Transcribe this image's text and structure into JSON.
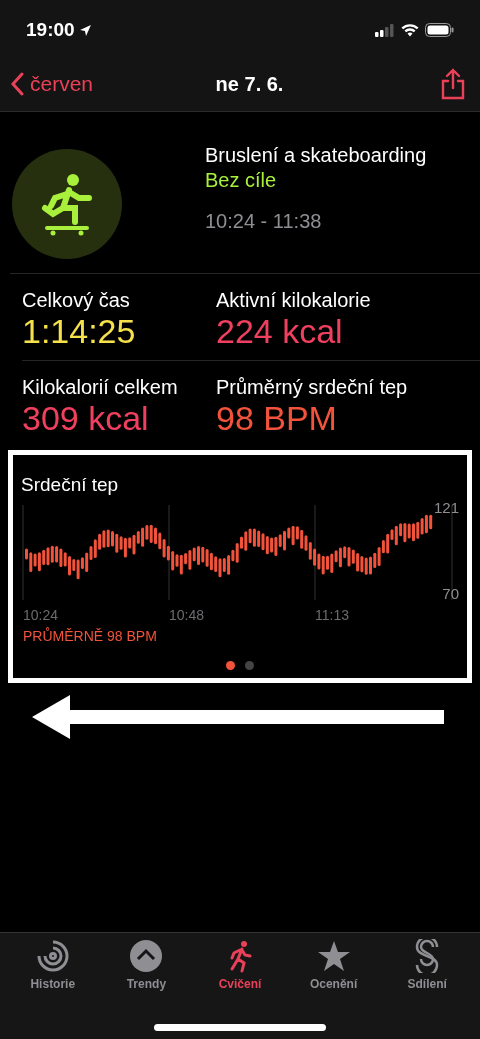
{
  "status_bar": {
    "time": "19:00"
  },
  "nav": {
    "back": "červen",
    "title": "ne 7. 6."
  },
  "workout": {
    "name": "Bruslení a skateboarding",
    "goal": "Bez cíle",
    "time_range": "10:24 - 11:38"
  },
  "metrics": [
    {
      "label": "Celkový čas",
      "value": "1:14:25",
      "color": "#f5e14a"
    },
    {
      "label": "Aktivní kilokalorie",
      "value": "224 kcal",
      "color": "#f0405f"
    },
    {
      "label": "Kilokalorií celkem",
      "value": "309 kcal",
      "color": "#f0405f"
    },
    {
      "label": "Průměrný srdeční tep",
      "value": "98 BPM",
      "color": "#f2533a"
    }
  ],
  "heart_rate": {
    "title": "Srdeční tep",
    "y_max": "121",
    "y_min": "70",
    "times": [
      "10:24",
      "10:48",
      "11:13"
    ],
    "average": "PRŮMĚRNĚ 98 BPM",
    "pages": [
      {
        "selected": true
      },
      {
        "selected": false
      }
    ]
  },
  "tabs": [
    {
      "label": "Historie",
      "selected": false
    },
    {
      "label": "Trendy",
      "selected": false
    },
    {
      "label": "Cvičení",
      "selected": true
    },
    {
      "label": "Ocenění",
      "selected": false
    },
    {
      "label": "Sdílení",
      "selected": false
    }
  ]
}
